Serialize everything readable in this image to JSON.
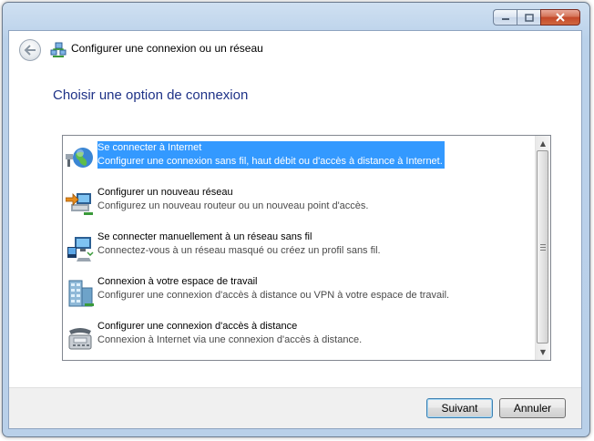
{
  "window": {
    "title": "Configurer une connexion ou un réseau",
    "caption_buttons": [
      "minimize",
      "maximize",
      "close"
    ]
  },
  "heading": "Choisir une option de connexion",
  "options": [
    {
      "icon": "internet-globe-icon",
      "title": "Se connecter à Internet",
      "description": "Configurer une connexion sans fil, haut débit ou d'accès à distance à Internet.",
      "selected": true
    },
    {
      "icon": "new-network-icon",
      "title": "Configurer un nouveau réseau",
      "description": "Configurez un nouveau routeur ou un nouveau point d'accès.",
      "selected": false
    },
    {
      "icon": "wireless-network-icon",
      "title": "Se connecter manuellement à un réseau sans fil",
      "description": "Connectez-vous à un réseau masqué ou créez un profil sans fil.",
      "selected": false
    },
    {
      "icon": "workplace-building-icon",
      "title": "Connexion à votre espace de travail",
      "description": "Configurer une connexion d'accès à distance ou VPN à votre espace de travail.",
      "selected": false
    },
    {
      "icon": "dialup-phone-icon",
      "title": "Configurer une connexion d'accès à distance",
      "description": "Connexion à Internet via une connexion d'accès à distance.",
      "selected": false
    }
  ],
  "buttons": {
    "next": "Suivant",
    "cancel": "Annuler"
  },
  "colors": {
    "heading": "#1e3287",
    "selection": "#3399ff",
    "titlebar": "#bad1ea"
  }
}
